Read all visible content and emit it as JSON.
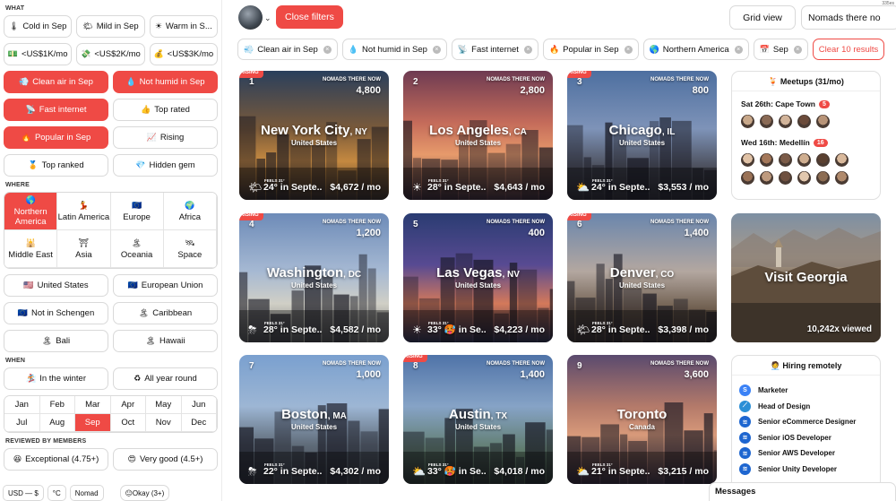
{
  "dims_label": "335es",
  "sidebar": {
    "what_title": "WHAT",
    "where_title": "WHERE",
    "when_title": "WHEN",
    "reviewed_title": "REVIEWED BY MEMBERS",
    "rows_what": [
      [
        {
          "icon": "🌡",
          "label": "Cold in Sep"
        },
        {
          "icon": "🌤",
          "label": "Mild in Sep"
        },
        {
          "icon": "☀",
          "label": "Warm in S..."
        }
      ],
      [
        {
          "icon": "💵",
          "label": "<US$1K/mo"
        },
        {
          "icon": "💸",
          "label": "<US$2K/mo"
        },
        {
          "icon": "💰",
          "label": "<US$3K/mo"
        }
      ],
      [
        {
          "icon": "💨",
          "label": "Clean air in Sep",
          "active": true
        },
        {
          "icon": "💧",
          "label": "Not humid in Sep",
          "active": true
        }
      ],
      [
        {
          "icon": "📡",
          "label": "Fast internet",
          "active": true
        },
        {
          "icon": "👍",
          "label": "Top rated"
        }
      ],
      [
        {
          "icon": "🔥",
          "label": "Popular in Sep",
          "active": true
        },
        {
          "icon": "📈",
          "label": "Rising"
        }
      ],
      [
        {
          "icon": "🏅",
          "label": "Top ranked"
        },
        {
          "icon": "💎",
          "label": "Hidden gem"
        }
      ]
    ],
    "regions": [
      {
        "icon": "🌎",
        "label": "Northern America",
        "active": true
      },
      {
        "icon": "💃",
        "label": "Latin America"
      },
      {
        "icon": "🇪🇺",
        "label": "Europe"
      },
      {
        "icon": "🌍",
        "label": "Africa"
      },
      {
        "icon": "🕌",
        "label": "Middle East"
      },
      {
        "icon": "⛩",
        "label": "Asia"
      },
      {
        "icon": "🏝",
        "label": "Oceania"
      },
      {
        "icon": "🛰",
        "label": "Space"
      }
    ],
    "rows_where": [
      [
        {
          "icon": "🇺🇸",
          "label": "United States"
        },
        {
          "icon": "🇪🇺",
          "label": "European Union"
        }
      ],
      [
        {
          "icon": "🇪🇺",
          "label": "Not in Schengen"
        },
        {
          "icon": "🏝",
          "label": "Caribbean"
        }
      ],
      [
        {
          "icon": "🏝",
          "label": "Bali"
        },
        {
          "icon": "🏝",
          "label": "Hawaii"
        }
      ]
    ],
    "rows_when": [
      [
        {
          "icon": "🏂",
          "label": "In the winter"
        },
        {
          "icon": "♻",
          "label": "All year round"
        }
      ]
    ],
    "months": [
      "Jan",
      "Feb",
      "Mar",
      "Apr",
      "May",
      "Jun",
      "Jul",
      "Aug",
      "Sep",
      "Oct",
      "Nov",
      "Dec"
    ],
    "active_month": "Sep",
    "rows_reviewed": [
      [
        {
          "icon": "😆",
          "label": "Exceptional (4.75+)"
        },
        {
          "icon": "😍",
          "label": "Very good (4.5+)"
        }
      ]
    ],
    "footer": [
      "USD — $",
      "°C",
      "Nomad"
    ],
    "okay_label": "Okay (3+)"
  },
  "topbar": {
    "close_filters": "Close filters",
    "grid_view": "Grid view",
    "nomads_now": "Nomads there no",
    "avatar_caret": "⌄"
  },
  "chips": [
    {
      "icon": "💨",
      "label": "Clean air in Sep"
    },
    {
      "icon": "💧",
      "label": "Not humid in Sep"
    },
    {
      "icon": "📡",
      "label": "Fast internet"
    },
    {
      "icon": "🔥",
      "label": "Popular in Sep"
    },
    {
      "icon": "🌎",
      "label": "Northern America"
    },
    {
      "icon": "📅",
      "label": "Sep"
    }
  ],
  "clear_label": "Clear 10 results",
  "cards": [
    {
      "rank": "1",
      "city": "New York City",
      "state": "NY",
      "country": "United States",
      "nomads": "4,800",
      "weather": "24° in Septe...",
      "cost": "$4,672 / mo",
      "rising": true,
      "wicon": "🌤"
    },
    {
      "rank": "2",
      "city": "Los Angeles",
      "state": "CA",
      "country": "United States",
      "nomads": "2,800",
      "weather": "28° in Septe...",
      "cost": "$4,643 / mo",
      "rising": false,
      "wicon": "☀"
    },
    {
      "rank": "3",
      "city": "Chicago",
      "state": "IL",
      "country": "United States",
      "nomads": "800",
      "weather": "24° in Septe...",
      "cost": "$3,553 / mo",
      "rising": true,
      "wicon": "⛅"
    },
    {
      "rank": "4",
      "city": "Washington",
      "state": "DC",
      "country": "United States",
      "nomads": "1,200",
      "weather": "28° in Septe...",
      "cost": "$4,582 / mo",
      "rising": true,
      "wicon": "⛈"
    },
    {
      "rank": "5",
      "city": "Las Vegas",
      "state": "NV",
      "country": "United States",
      "nomads": "400",
      "weather": "33° 🥵 in Se...",
      "cost": "$4,223 / mo",
      "rising": false,
      "wicon": "☀"
    },
    {
      "rank": "6",
      "city": "Denver",
      "state": "CO",
      "country": "United States",
      "nomads": "1,400",
      "weather": "28° in Septe...",
      "cost": "$3,398 / mo",
      "rising": true,
      "wicon": "🌤"
    },
    {
      "rank": "7",
      "city": "Boston",
      "state": "MA",
      "country": "United States",
      "nomads": "1,000",
      "weather": "22° in Septe...",
      "cost": "$4,302 / mo",
      "rising": false,
      "wicon": "⛈"
    },
    {
      "rank": "8",
      "city": "Austin",
      "state": "TX",
      "country": "United States",
      "nomads": "1,400",
      "weather": "33° 🥵 in Se...",
      "cost": "$4,018 / mo",
      "rising": true,
      "wicon": "⛅"
    },
    {
      "rank": "9",
      "city": "Toronto",
      "state": "",
      "country": "Canada",
      "nomads": "3,600",
      "weather": "21° in Septe...",
      "cost": "$3,215 / mo",
      "rising": false,
      "wicon": "⛅"
    }
  ],
  "card_labels": {
    "nomads_label": "NOMADS THERE NOW",
    "rising_label": "RISING",
    "feels_label": "FEELS 31°"
  },
  "meetups": {
    "title": "🍹 Meetups (31/mo)",
    "events": [
      {
        "label": "Sat 26th: Cape Town",
        "count": "5"
      },
      {
        "label": "Wed 16th: Medellín",
        "count": "16"
      }
    ]
  },
  "georgia": {
    "title": "Visit Georgia",
    "views": "10,242x viewed"
  },
  "hiring": {
    "title": "🧑‍💼 Hiring remotely",
    "jobs": [
      {
        "logo": "S",
        "color": "#3b82f6",
        "label": "Marketer"
      },
      {
        "logo": "⟋",
        "color": "#2b8fd6",
        "label": "Head of Design"
      },
      {
        "logo": "≋",
        "color": "#1e66d0",
        "label": "Senior eCommerce Designer"
      },
      {
        "logo": "≋",
        "color": "#1e66d0",
        "label": "Senior iOS Developer"
      },
      {
        "logo": "≋",
        "color": "#1e66d0",
        "label": "Senior AWS Developer"
      },
      {
        "logo": "≋",
        "color": "#1e66d0",
        "label": "Senior Unity Developer"
      }
    ]
  },
  "messages_label": "Messages"
}
